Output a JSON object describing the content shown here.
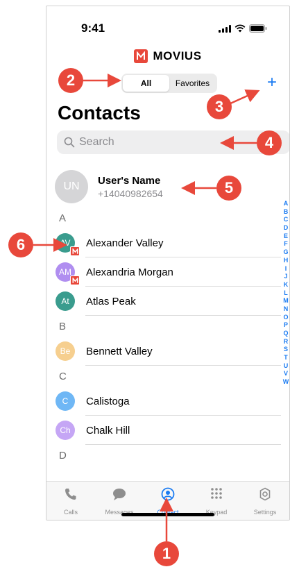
{
  "status": {
    "time": "9:41"
  },
  "brand": {
    "name": "MOVIUS",
    "color": "#e8483b"
  },
  "segments": {
    "all": "All",
    "favorites": "Favorites"
  },
  "header": {
    "add": "+",
    "title": "Contacts"
  },
  "search": {
    "placeholder": "Search"
  },
  "me": {
    "initials": "UN",
    "name": "User's Name",
    "phone": "+14040982654"
  },
  "sections": [
    {
      "letter": "A",
      "contacts": [
        {
          "initials": "AV",
          "name": "Alexander Valley",
          "color": "#3a9c8e",
          "movius": true
        },
        {
          "initials": "AM",
          "name": "Alexandria Morgan",
          "color": "#b08ef0",
          "movius": true
        },
        {
          "initials": "At",
          "name": "Atlas Peak",
          "color": "#3a9c8e",
          "movius": false
        }
      ]
    },
    {
      "letter": "B",
      "contacts": [
        {
          "initials": "Be",
          "name": "Bennett Valley",
          "color": "#f6cf8f",
          "movius": false
        }
      ]
    },
    {
      "letter": "C",
      "contacts": [
        {
          "initials": "C",
          "name": "Calistoga",
          "color": "#6fb7f5",
          "movius": false
        },
        {
          "initials": "Ch",
          "name": "Chalk Hill",
          "color": "#c5a6f5",
          "movius": false
        }
      ]
    },
    {
      "letter": "D",
      "contacts": []
    }
  ],
  "index_letters": [
    "A",
    "B",
    "C",
    "D",
    "E",
    "F",
    "G",
    "H",
    "I",
    "J",
    "K",
    "L",
    "M",
    "N",
    "O",
    "P",
    "Q",
    "R",
    "S",
    "T",
    "U",
    "V",
    "W"
  ],
  "tabs": [
    {
      "label": "Calls",
      "icon": "phone-icon"
    },
    {
      "label": "Messages",
      "icon": "message-icon"
    },
    {
      "label": "Contact",
      "icon": "contact-icon"
    },
    {
      "label": "Keypad",
      "icon": "keypad-icon"
    },
    {
      "label": "Settings",
      "icon": "gear-icon"
    }
  ],
  "callouts": {
    "c1": "1",
    "c2": "2",
    "c3": "3",
    "c4": "4",
    "c5": "5",
    "c6": "6"
  },
  "colors": {
    "accent": "#1a7bf2",
    "callout": "#e8483b"
  }
}
